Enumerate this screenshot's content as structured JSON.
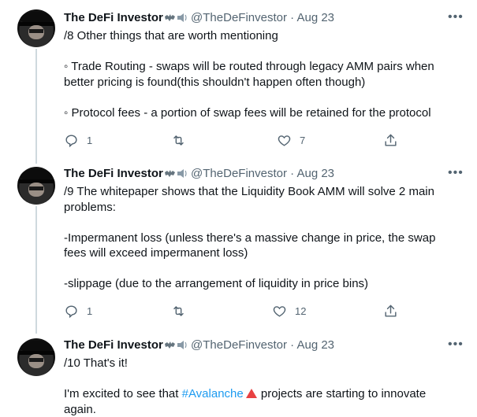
{
  "tweets": [
    {
      "name": "The DeFi Investor",
      "handle": "@TheDeFinvestor",
      "separator": "·",
      "date": "Aug 23",
      "more": "•••",
      "lines": [
        "/8 Other things that are worth mentioning",
        "",
        "◦ Trade Routing - swaps will be routed through legacy AMM pairs when better pricing is found(this shouldn't happen often though)",
        "",
        "◦ Protocol fees - a portion of swap fees will be retained for the protocol"
      ],
      "replies": "1",
      "retweets": "",
      "likes": "7"
    },
    {
      "name": "The DeFi Investor",
      "handle": "@TheDeFinvestor",
      "separator": "·",
      "date": "Aug 23",
      "more": "•••",
      "lines": [
        "/9 The whitepaper shows that the Liquidity Book AMM will solve 2 main problems:",
        "",
        "-Impermanent loss (unless there's a massive change in price, the swap fees will exceed impermanent loss)",
        "",
        "-slippage (due to the arrangement of liquidity in price bins)"
      ],
      "replies": "1",
      "retweets": "",
      "likes": "12"
    },
    {
      "name": "The DeFi Investor",
      "handle": "@TheDeFinvestor",
      "separator": "·",
      "date": "Aug 23",
      "more": "•••",
      "line1": "/10 That's it!",
      "line3_before": " I'm excited to see that ",
      "hashtag": "#Avalanche",
      "line3_after": " projects are starting to innovate again."
    }
  ],
  "icons": {
    "reply": "reply-icon",
    "retweet": "retweet-icon",
    "like": "heart-icon",
    "share": "share-icon",
    "badge": "bat-and-speaker-emoji",
    "avalanche": "red-triangle-emoji"
  },
  "colors": {
    "text": "#0f1419",
    "secondary": "#536471",
    "link": "#1d9bf0",
    "thread_line": "#cfd9de",
    "avalanche_red": "#e84142"
  }
}
